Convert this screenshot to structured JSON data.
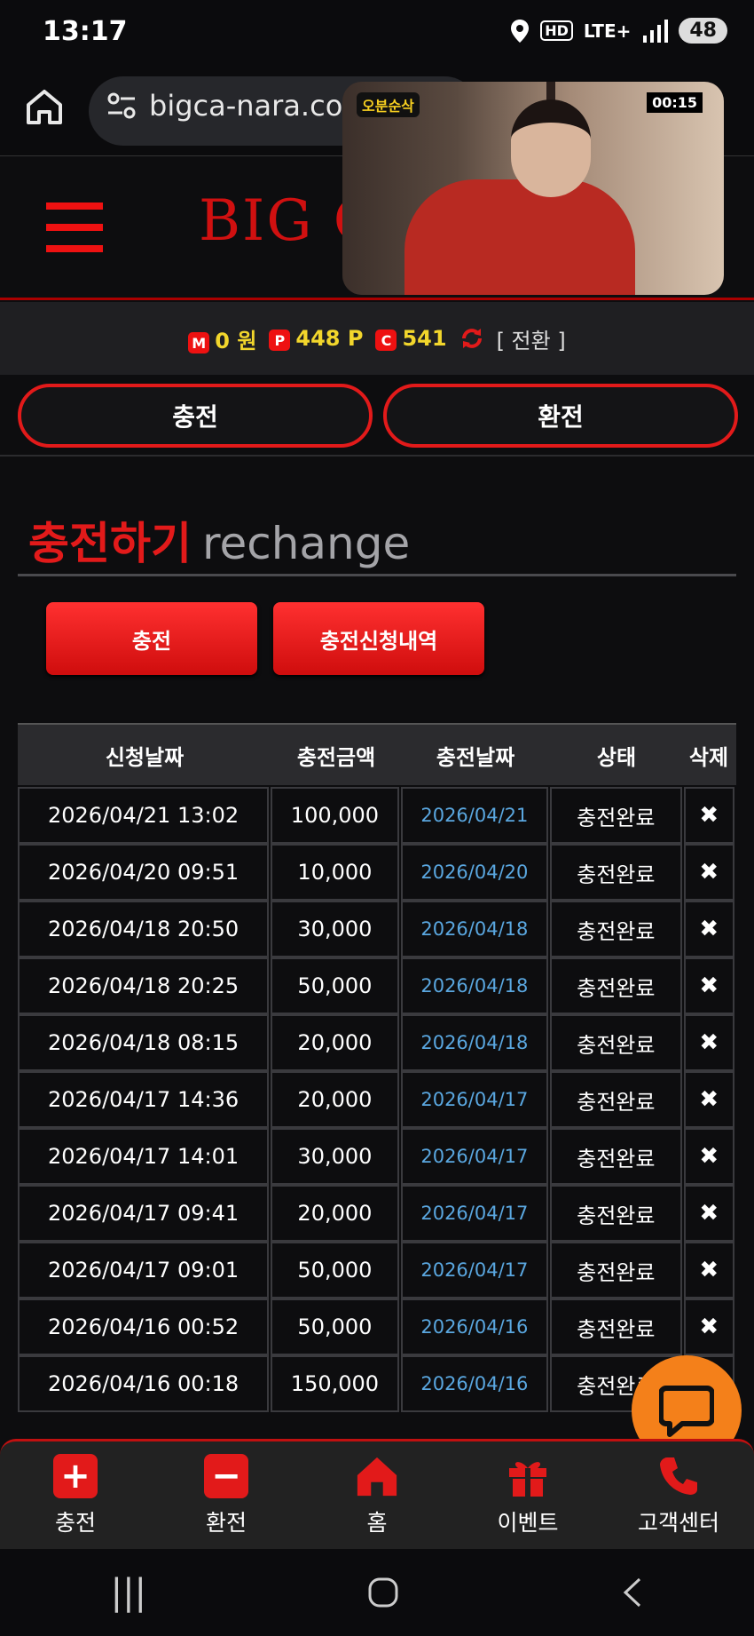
{
  "status_bar": {
    "time": "13:17",
    "network": "LTE+",
    "hd": "HD",
    "battery": "48"
  },
  "browser": {
    "url": "bigca-nara.com"
  },
  "header": {
    "logo": "BIG C"
  },
  "video_overlay": {
    "timer": "00:15",
    "badge": "오분순삭"
  },
  "balance": {
    "money_badge": "M",
    "money": "0 원",
    "point_badge": "P",
    "point": "448 P",
    "coin_badge": "C",
    "coin": "541",
    "convert_label": "[ 전환 ]"
  },
  "top_tabs": {
    "charge": "충전",
    "exchange": "환전"
  },
  "section": {
    "title_kr": "충전하기",
    "title_en": "rechange"
  },
  "buttons": {
    "charge": "충전",
    "history": "충전신청내역"
  },
  "table": {
    "headers": [
      "신청날짜",
      "충전금액",
      "충전날짜",
      "상태",
      "삭제"
    ],
    "rows": [
      {
        "req": "2026/04/21 13:02",
        "amount": "100,000",
        "date": "2026/04/21",
        "status": "충전완료",
        "del": "✖"
      },
      {
        "req": "2026/04/20 09:51",
        "amount": "10,000",
        "date": "2026/04/20",
        "status": "충전완료",
        "del": "✖"
      },
      {
        "req": "2026/04/18 20:50",
        "amount": "30,000",
        "date": "2026/04/18",
        "status": "충전완료",
        "del": "✖"
      },
      {
        "req": "2026/04/18 20:25",
        "amount": "50,000",
        "date": "2026/04/18",
        "status": "충전완료",
        "del": "✖"
      },
      {
        "req": "2026/04/18 08:15",
        "amount": "20,000",
        "date": "2026/04/18",
        "status": "충전완료",
        "del": "✖"
      },
      {
        "req": "2026/04/17 14:36",
        "amount": "20,000",
        "date": "2026/04/17",
        "status": "충전완료",
        "del": "✖"
      },
      {
        "req": "2026/04/17 14:01",
        "amount": "30,000",
        "date": "2026/04/17",
        "status": "충전완료",
        "del": "✖"
      },
      {
        "req": "2026/04/17 09:41",
        "amount": "20,000",
        "date": "2026/04/17",
        "status": "충전완료",
        "del": "✖"
      },
      {
        "req": "2026/04/17 09:01",
        "amount": "50,000",
        "date": "2026/04/17",
        "status": "충전완료",
        "del": "✖"
      },
      {
        "req": "2026/04/16 00:52",
        "amount": "50,000",
        "date": "2026/04/16",
        "status": "충전완료",
        "del": "✖"
      },
      {
        "req": "2026/04/16 00:18",
        "amount": "150,000",
        "date": "2026/04/16",
        "status": "충전완료",
        "del": "✖"
      }
    ]
  },
  "bottom_nav": [
    {
      "label": "충전",
      "icon": "plus-icon"
    },
    {
      "label": "환전",
      "icon": "minus-icon"
    },
    {
      "label": "홈",
      "icon": "home-icon"
    },
    {
      "label": "이벤트",
      "icon": "gift-icon"
    },
    {
      "label": "고객센터",
      "icon": "phone-icon"
    }
  ],
  "colors": {
    "accent": "#e21a1a",
    "gold": "#f2d62c",
    "link": "#5aa7e0",
    "chat": "#f4801a"
  }
}
